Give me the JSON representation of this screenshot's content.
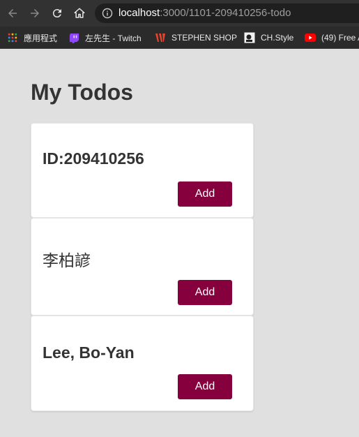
{
  "browser": {
    "url_host": "localhost",
    "url_path": ":3000/1101-209410256-todo",
    "bookmarks": [
      {
        "label": "應用程式",
        "icon": "apps-grid-icon"
      },
      {
        "label": "左先生 - Twitch",
        "icon": "twitch-icon"
      },
      {
        "label": "STEPHEN SHOP",
        "icon": "stephen-shop-icon"
      },
      {
        "label": "CH.Style",
        "icon": "chstyle-icon"
      },
      {
        "label": "(49) Free A",
        "icon": "youtube-icon"
      }
    ]
  },
  "page": {
    "title": "My Todos",
    "todos": [
      {
        "text": "ID:209410256",
        "button_label": "Add"
      },
      {
        "text": "李柏諺",
        "button_label": "Add"
      },
      {
        "text": "Lee, Bo-Yan",
        "button_label": "Add"
      }
    ]
  },
  "colors": {
    "page_background": "#e0e0e0",
    "button_background": "#85003d",
    "title_text": "#333333",
    "browser_toolbar": "#323232",
    "bookmark_bar": "#2b2b2b"
  }
}
